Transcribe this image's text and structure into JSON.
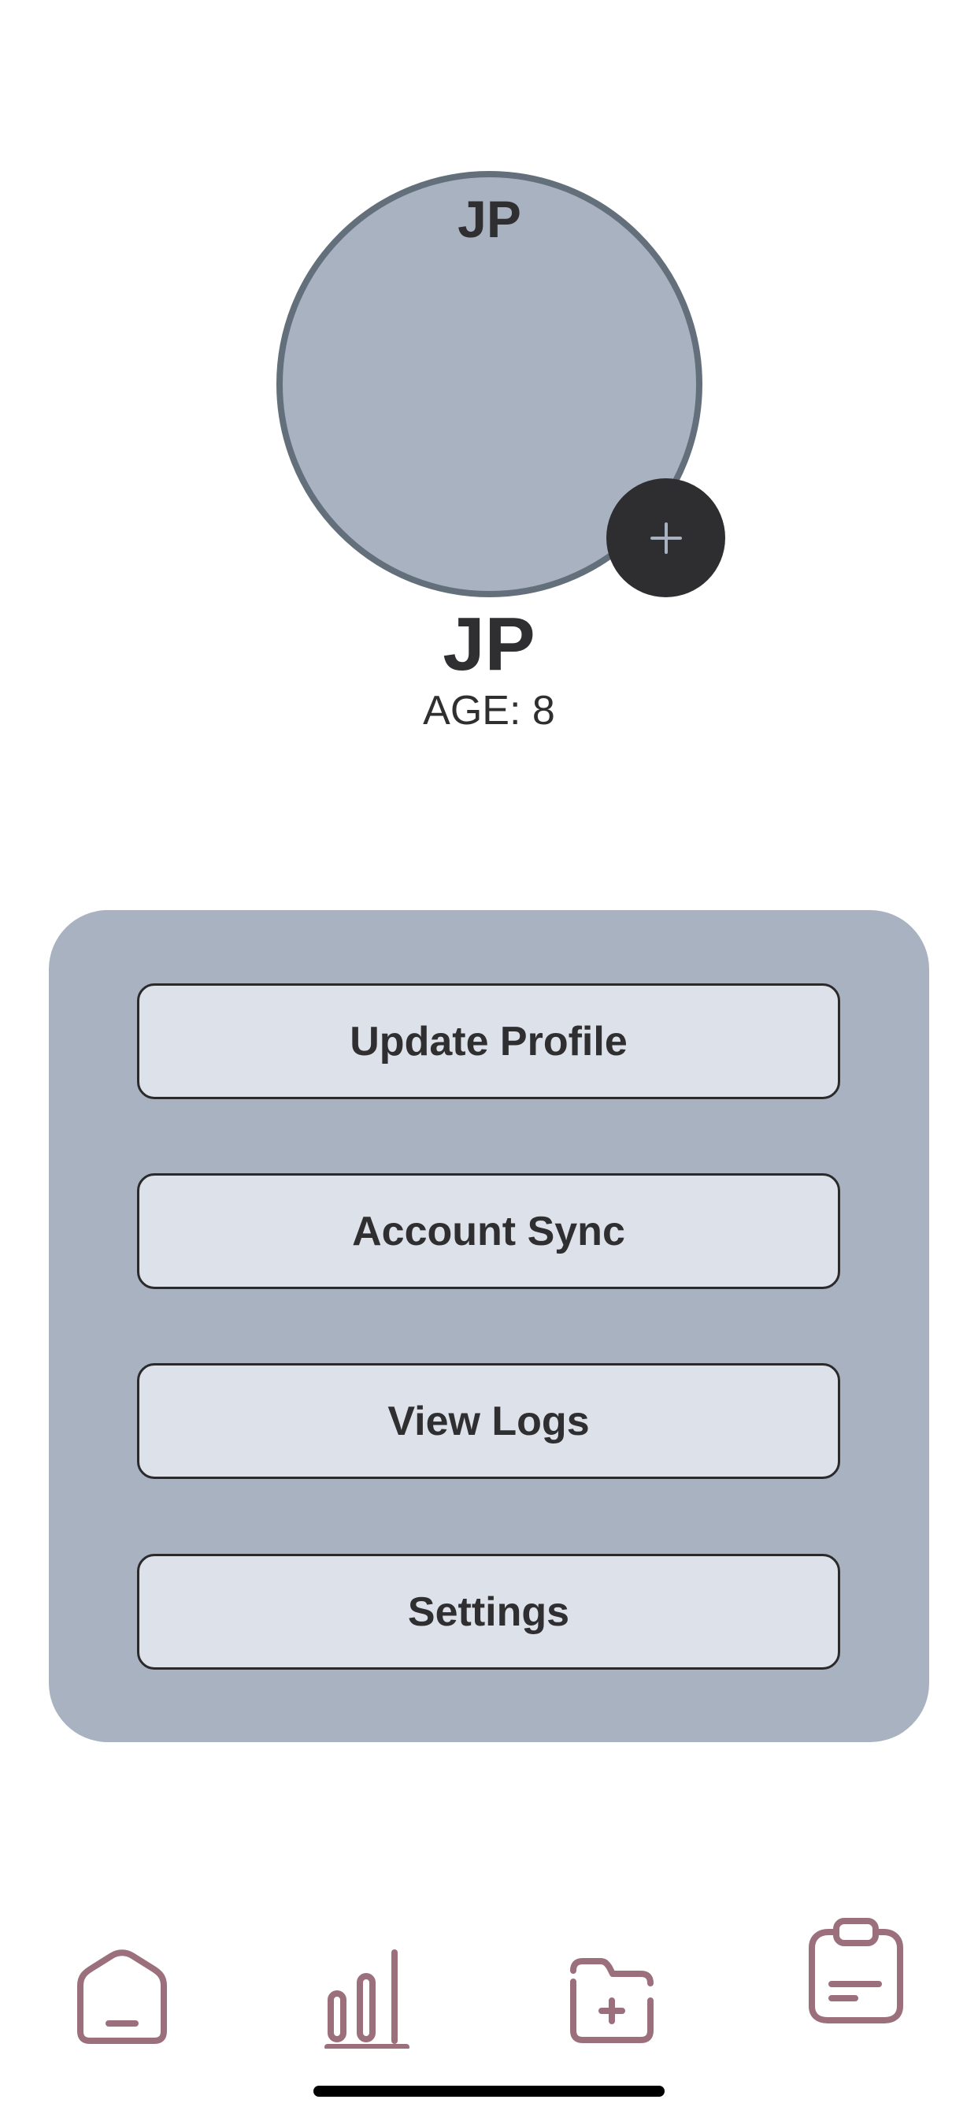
{
  "profile": {
    "avatar_initials": "JP",
    "name": "JP",
    "age": "AGE: 8"
  },
  "menu": {
    "items": [
      {
        "label": "Update Profile"
      },
      {
        "label": "Account Sync"
      },
      {
        "label": "View Logs"
      },
      {
        "label": "Settings"
      }
    ]
  },
  "tab_bar": {
    "tabs": [
      {
        "icon": "home-icon"
      },
      {
        "icon": "bar-chart-icon"
      },
      {
        "icon": "folder-add-icon"
      },
      {
        "icon": "clipboard-icon"
      }
    ]
  },
  "colors": {
    "avatar_fill": "#a8b2c0",
    "avatar_border": "#646f7c",
    "add_button": "#2e2e30",
    "card_background": "#a8b2c0",
    "button_background": "#dde1e9",
    "tab_icon": "#9b6f7b",
    "text": "#2f2f31"
  }
}
